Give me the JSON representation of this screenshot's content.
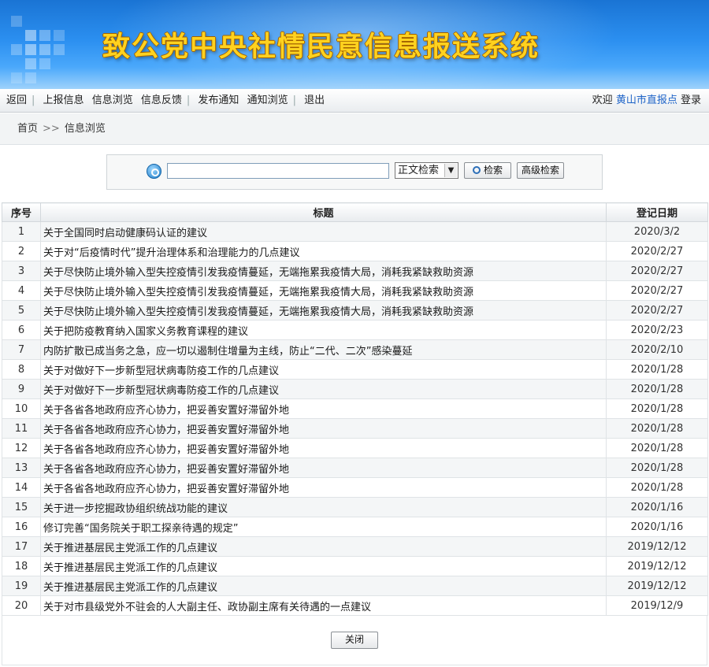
{
  "header": {
    "title": "致公党中央社情民意信息报送系统"
  },
  "nav": {
    "items": [
      "返回",
      "上报信息",
      "信息浏览",
      "信息反馈",
      "发布通知",
      "通知浏览",
      "退出"
    ],
    "welcome": "欢迎",
    "user": "黄山市直报点",
    "login": "登录"
  },
  "breadcrumb": {
    "home": "首页",
    "arrows": ">>",
    "current": "信息浏览"
  },
  "search": {
    "value": "",
    "select_value": "正文检索",
    "search_button": "检索",
    "advanced_button": "高级检索"
  },
  "table": {
    "headers": [
      "序号",
      "标题",
      "登记日期"
    ],
    "rows": [
      {
        "idx": "1",
        "title": "关于全国同时启动健康码认证的建议",
        "date": "2020/3/2"
      },
      {
        "idx": "2",
        "title": "关于对“后疫情时代”提升治理体系和治理能力的几点建议",
        "date": "2020/2/27"
      },
      {
        "idx": "3",
        "title": "关于尽快防止境外输入型失控疫情引发我疫情蔓延，无端拖累我疫情大局，消耗我紧缺救助资源",
        "date": "2020/2/27"
      },
      {
        "idx": "4",
        "title": "关于尽快防止境外输入型失控疫情引发我疫情蔓延，无端拖累我疫情大局，消耗我紧缺救助资源",
        "date": "2020/2/27"
      },
      {
        "idx": "5",
        "title": "关于尽快防止境外输入型失控疫情引发我疫情蔓延，无端拖累我疫情大局，消耗我紧缺救助资源",
        "date": "2020/2/27"
      },
      {
        "idx": "6",
        "title": "关于把防疫教育纳入国家义务教育课程的建议",
        "date": "2020/2/23"
      },
      {
        "idx": "7",
        "title": "内防扩散已成当务之急，应一切以遏制住增量为主线，防止“二代、二次”感染蔓延",
        "date": "2020/2/10"
      },
      {
        "idx": "8",
        "title": "关于对做好下一步新型冠状病毒防疫工作的几点建议",
        "date": "2020/1/28"
      },
      {
        "idx": "9",
        "title": "关于对做好下一步新型冠状病毒防疫工作的几点建议",
        "date": "2020/1/28"
      },
      {
        "idx": "10",
        "title": "关于各省各地政府应齐心协力，把妥善安置好滞留外地",
        "date": "2020/1/28"
      },
      {
        "idx": "11",
        "title": "关于各省各地政府应齐心协力，把妥善安置好滞留外地",
        "date": "2020/1/28"
      },
      {
        "idx": "12",
        "title": "关于各省各地政府应齐心协力，把妥善安置好滞留外地",
        "date": "2020/1/28"
      },
      {
        "idx": "13",
        "title": "关于各省各地政府应齐心协力，把妥善安置好滞留外地",
        "date": "2020/1/28"
      },
      {
        "idx": "14",
        "title": "关于各省各地政府应齐心协力，把妥善安置好滞留外地",
        "date": "2020/1/28"
      },
      {
        "idx": "15",
        "title": "关于进一步挖掘政协组织统战功能的建议",
        "date": "2020/1/16"
      },
      {
        "idx": "16",
        "title": "修订完善“国务院关于职工探亲待遇的规定”",
        "date": "2020/1/16"
      },
      {
        "idx": "17",
        "title": "关于推进基层民主党派工作的几点建议",
        "date": "2019/12/12"
      },
      {
        "idx": "18",
        "title": "关于推进基层民主党派工作的几点建议",
        "date": "2019/12/12"
      },
      {
        "idx": "19",
        "title": "关于推进基层民主党派工作的几点建议",
        "date": "2019/12/12"
      },
      {
        "idx": "20",
        "title": "关于对市县级党外不驻会的人大副主任、政协副主席有关待遇的一点建议",
        "date": "2019/12/9"
      }
    ]
  },
  "footer": {
    "close_button": "关闭"
  },
  "colors": {
    "banner": "#2b8ff0",
    "title": "#ffd21f",
    "link": "#1f64c8"
  }
}
